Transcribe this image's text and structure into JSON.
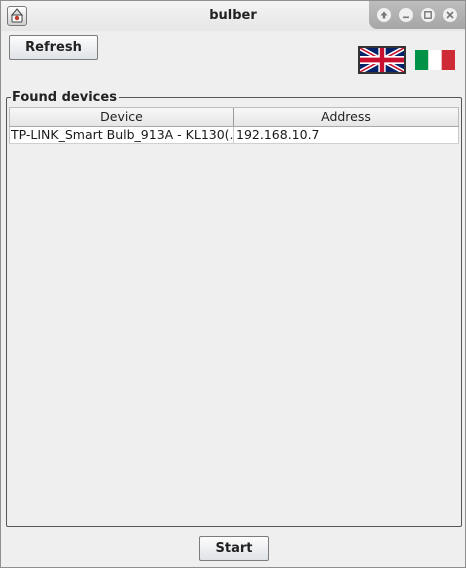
{
  "window": {
    "title": "bulber"
  },
  "toolbar": {
    "refresh_label": "Refresh"
  },
  "languages": [
    {
      "code": "en",
      "icon": "uk-flag-icon",
      "selected": true
    },
    {
      "code": "it",
      "icon": "italy-flag-icon",
      "selected": false
    }
  ],
  "found_devices": {
    "title": "Found devices",
    "columns": [
      "Device",
      "Address"
    ],
    "rows": [
      {
        "device": "TP-LINK_Smart Bulb_913A - KL130(...",
        "address": "192.168.10.7"
      }
    ]
  },
  "footer": {
    "start_label": "Start"
  }
}
